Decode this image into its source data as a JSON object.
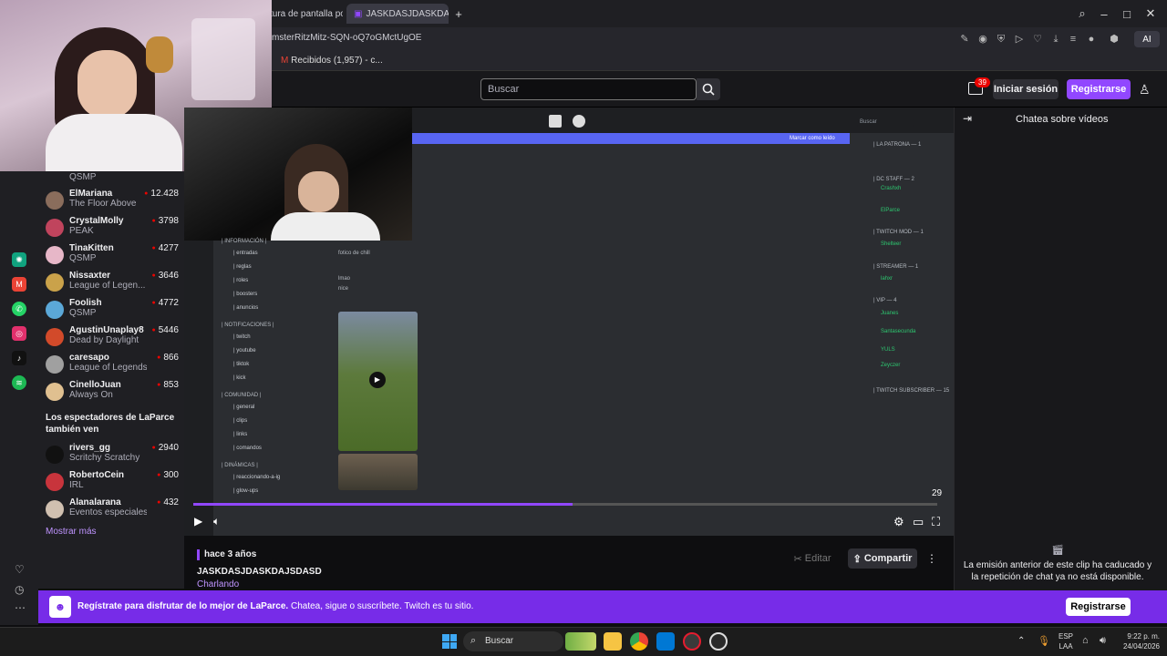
{
  "browser": {
    "tabs": [
      "tura de pantalla por L",
      "JASKDASJDASKDASJDASD"
    ],
    "url": "msterRitzMitz-SQN-oQ7oGMctUgOE",
    "bookmark": "Recibidos (1,957) - c...",
    "ai_label": "AI"
  },
  "header": {
    "search_placeholder": "Buscar",
    "notif_count": "39",
    "login": "Iniciar sesión",
    "register": "Registrarse"
  },
  "sidebar": {
    "top_game": "QSMP",
    "channels": [
      {
        "name": "ElMariana",
        "game": "The Floor Above",
        "viewers": "12.428",
        "color": "#8a6d5c"
      },
      {
        "name": "CrystalMolly",
        "game": "PEAK",
        "viewers": "3798",
        "color": "#c0445d"
      },
      {
        "name": "TinaKitten",
        "game": "QSMP",
        "viewers": "4277",
        "color": "#e7b7c8"
      },
      {
        "name": "Nissaxter",
        "game": "League of Legen...",
        "viewers": "3646",
        "color": "#caa24a"
      },
      {
        "name": "Foolish",
        "game": "QSMP",
        "viewers": "4772",
        "color": "#5ba8d8"
      },
      {
        "name": "AgustinUnaplay8",
        "game": "Dead by Daylight",
        "viewers": "5446",
        "color": "#d24a2a"
      },
      {
        "name": "caresapo",
        "game": "League of Legends",
        "viewers": "866",
        "color": "#a0a0a0"
      },
      {
        "name": "CinelloJuan",
        "game": "Always On",
        "viewers": "853",
        "color": "#e0c090"
      }
    ],
    "section_title": "Los espectadores de LaParce también ven",
    "also": [
      {
        "name": "rivers_gg",
        "game": "Scritchy Scratchy",
        "viewers": "2940",
        "color": "#111111"
      },
      {
        "name": "RobertoCein",
        "game": "IRL",
        "viewers": "300",
        "color": "#c8343c"
      },
      {
        "name": "Alanalarana",
        "game": "Eventos especiales",
        "viewers": "432",
        "color": "#d0c0b0"
      }
    ],
    "show_more": "Mostrar más"
  },
  "video": {
    "discord": {
      "mark_read": "Marcar como leído",
      "search": "Buscar",
      "msg_fotico": "fotico de chill",
      "msg_lmao": "lmao",
      "msg_nice": "nice",
      "chan_sections": [
        "| INFORMACIÓN |",
        "| NOTIFICACIONES |",
        "| COMUNIDAD |",
        "| DINÁMICAS |"
      ],
      "channels": [
        "| entradas",
        "| reglas",
        "| roles",
        "| boosters",
        "| anuncios",
        "| twitch",
        "| youtube",
        "| tiktok",
        "| kick",
        "| general",
        "| clips",
        "| links",
        "| comandos",
        "| reaccionando-a-ig",
        "| glow-ups"
      ],
      "members": [
        "| LA PATRONA — 1",
        "| DC STAFF — 2",
        "Crashxh",
        "ElParce",
        "| TWITCH MOD — 1",
        "Shelteer",
        "| STREAMER — 1",
        "lahxr",
        "| VIP — 4",
        "Juanes",
        "Santasecunda",
        "YULS",
        "Zeyczer",
        "| TWITCH SUBSCRIBER — 15"
      ]
    },
    "counter": "29"
  },
  "clip": {
    "time_ago": "hace 3 años",
    "title": "JASKDASJDASKDAJSDASD",
    "category": "Charlando",
    "edit": "Editar",
    "share": "Compartir"
  },
  "chat": {
    "header": "Chatea sobre vídeos",
    "expired": "La emisión anterior de este clip ha caducado y la repetición de chat ya no está disponible."
  },
  "banner": {
    "text_bold": "Regístrate para disfrutar de lo mejor de LaParce.",
    "text_rest": " Chatea, sigue o suscríbete. Twitch es tu sitio.",
    "button": "Registrarse"
  },
  "taskbar": {
    "search": "Buscar",
    "lang_top": "ESP",
    "lang_bottom": "LAA",
    "time": "9:22 p. m.",
    "date": "24/04/2026"
  },
  "colors": {
    "accent": "#9147ff",
    "live": "#eb0400",
    "banner": "#772ce8"
  }
}
